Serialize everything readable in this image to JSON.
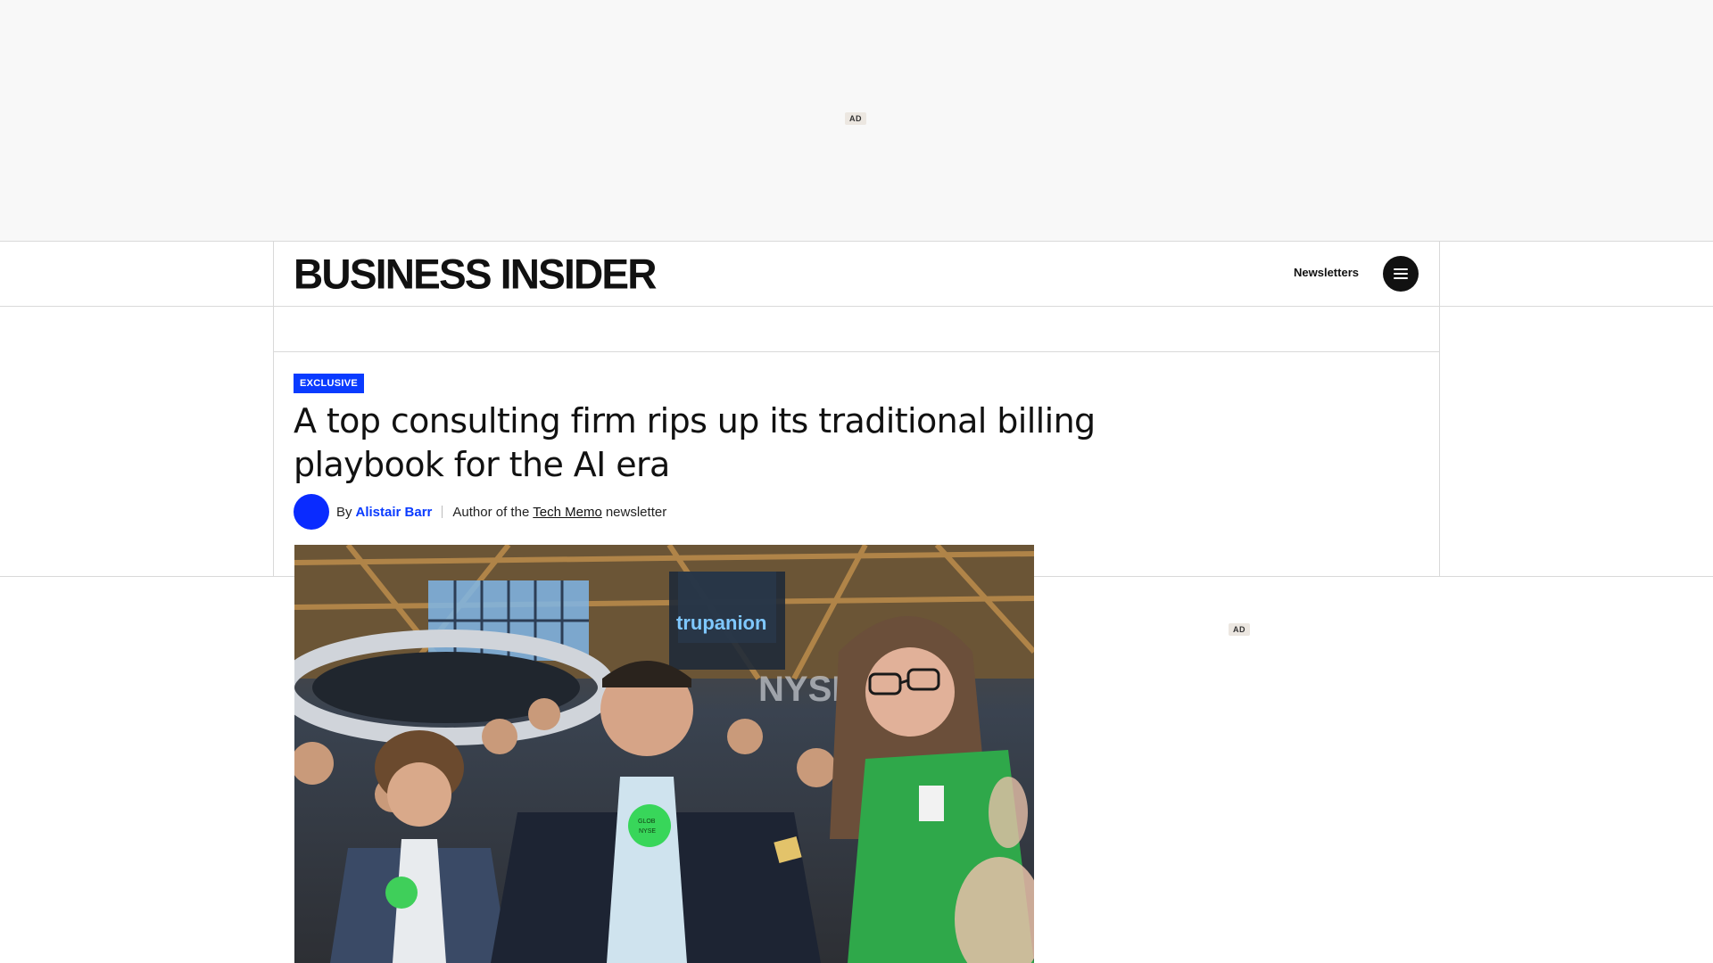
{
  "ads": {
    "top_label": "AD",
    "side_label": "AD"
  },
  "header": {
    "logo": "BUSINESS INSIDER",
    "newsletters_label": "Newsletters",
    "menu_icon": "hamburger-menu-icon"
  },
  "article": {
    "badge": "EXCLUSIVE",
    "headline": "A top consulting firm rips up its traditional billing playbook for the AI era",
    "byline": {
      "prefix": "By",
      "author": "Alistair Barr",
      "role_prefix": "Author of the",
      "newsletter": "Tech Memo",
      "role_suffix": "newsletter"
    },
    "hero_image": {
      "badge_text_1": "GLOB",
      "badge_text_2": "NYSE",
      "screen_text": "trupanion",
      "nyse_text": "NYSE"
    }
  },
  "colors": {
    "accent_blue": "#0a3bff",
    "ad_band": "#f8f8f8",
    "rule": "#d9d9d9"
  }
}
